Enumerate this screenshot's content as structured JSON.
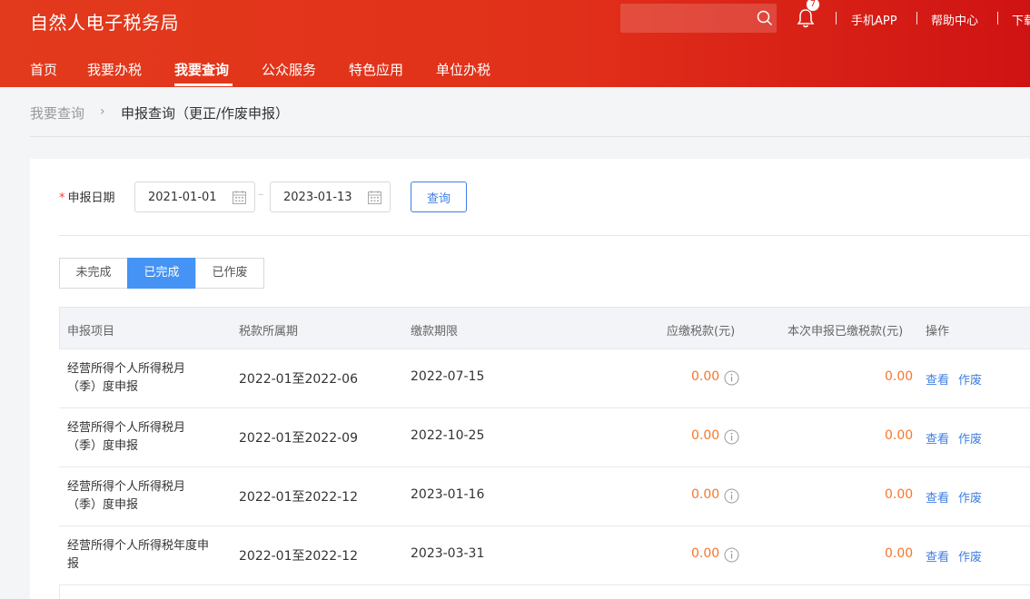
{
  "header": {
    "title": "自然人电子税务局",
    "search_placeholder": "",
    "notification_count": "7",
    "links": [
      "手机APP",
      "帮助中心",
      "下载"
    ]
  },
  "nav": {
    "items": [
      "首页",
      "我要办税",
      "我要查询",
      "公众服务",
      "特色应用",
      "单位办税"
    ],
    "active": "我要查询"
  },
  "breadcrumb": {
    "parent": "我要查询",
    "separator": "›",
    "current": "申报查询（更正/作废申报）"
  },
  "filter": {
    "required_mark": "*",
    "label": "申报日期",
    "start_date": "2021-01-01",
    "dash": "–",
    "end_date": "2023-01-13",
    "query_button": "查询"
  },
  "tabs": [
    {
      "label": "未完成",
      "active": false
    },
    {
      "label": "已完成",
      "active": true
    },
    {
      "label": "已作废",
      "active": false
    }
  ],
  "table": {
    "headers": [
      "申报项目",
      "税款所属期",
      "缴款期限",
      "应缴税款(元)",
      "本次申报已缴税款(元)",
      "操作"
    ],
    "rows": [
      {
        "item_line1": "经营所得个人所得税月",
        "item_line2": "（季）度申报",
        "period": "2022-01至2022-06",
        "deadline": "2022-07-15",
        "tax_due": "0.00",
        "tax_paid": "0.00",
        "action_view": "查看",
        "action_void": "作废"
      },
      {
        "item_line1": "经营所得个人所得税月",
        "item_line2": "（季）度申报",
        "period": "2022-01至2022-09",
        "deadline": "2022-10-25",
        "tax_due": "0.00",
        "tax_paid": "0.00",
        "action_view": "查看",
        "action_void": "作废"
      },
      {
        "item_line1": "经营所得个人所得税月",
        "item_line2": "（季）度申报",
        "period": "2022-01至2022-12",
        "deadline": "2023-01-16",
        "tax_due": "0.00",
        "tax_paid": "0.00",
        "action_view": "查看",
        "action_void": "作废"
      },
      {
        "item_line1": "经营所得个人所得税年度申",
        "item_line2": "报",
        "period": "2022-01至2022-12",
        "deadline": "2023-03-31",
        "tax_due": "0.00",
        "tax_paid": "0.00",
        "action_view": "查看",
        "action_void": "作废"
      }
    ]
  },
  "colors": {
    "header_red": "#e1301a",
    "accent_blue": "#3f7fe0",
    "tab_active": "#4593f5",
    "amount_orange": "#f5762a"
  }
}
